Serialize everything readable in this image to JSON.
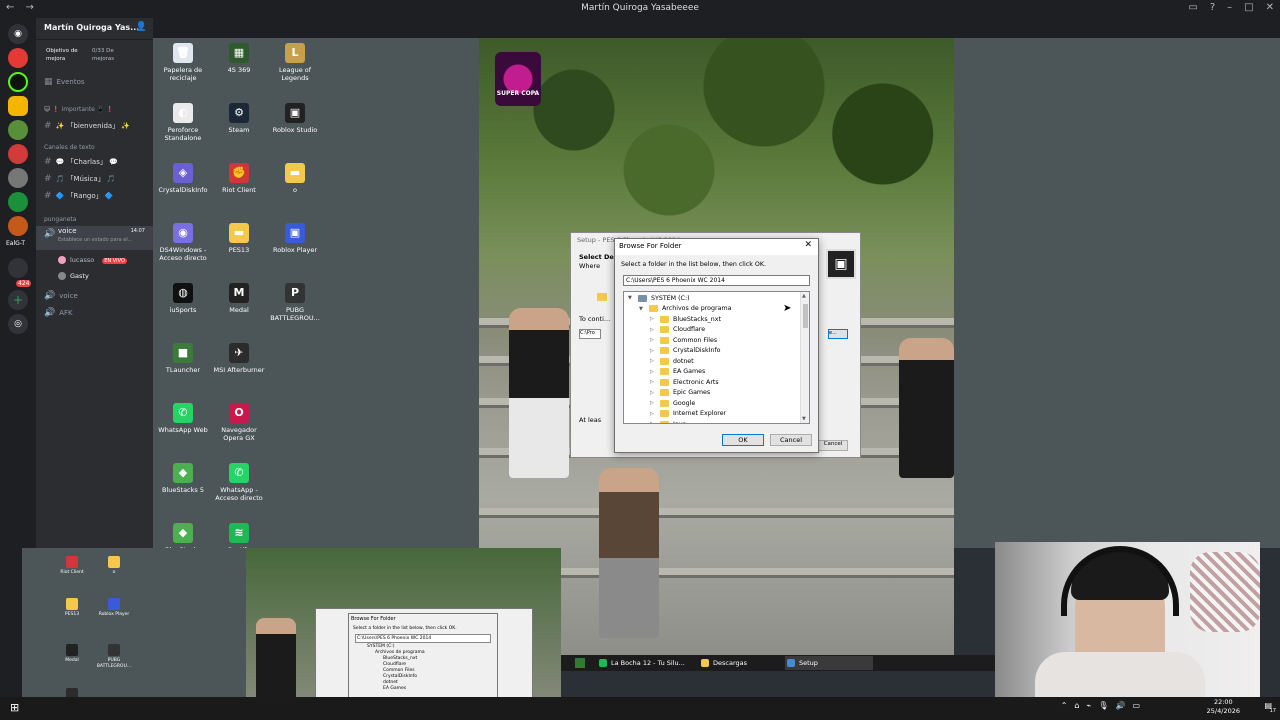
{
  "titlebar": {
    "title": "Martín Quiroga Yasabeeee",
    "nav": "← →"
  },
  "guild": {
    "name": "Martín Quiroga Yas...",
    "goal_label": "Objetivo de mejora",
    "goal_value": "0/33 De mejoras",
    "events": "Eventos"
  },
  "channels": {
    "important_cat": "😺 ❗ importante 📱 ❗",
    "welcome": "✨ 「bienvenida」 ✨",
    "text_cat": "Canales de texto",
    "chat": "💬 「Charlas」 💬",
    "music": "🎵 「Música」 🎵",
    "ranks": "🔷 「Rango」 🔷",
    "voice_cat": "punganeta",
    "voice_active": "voice",
    "voice_time": "14:07",
    "voice_status": "Establece un estado para el...",
    "user1": "lucasso",
    "user1_badge": "EN VIVO",
    "user2": "Gasty",
    "voice2": "voice",
    "afk": "AFK",
    "rail_badge": "424",
    "rail_label": "EalG-T"
  },
  "desktop_icons": [
    {
      "label": "Papelera de reciclaje",
      "color": "#dfe6ee",
      "glyph": "🗑"
    },
    {
      "label": "4S 369",
      "color": "#2e5a2e",
      "glyph": "▦"
    },
    {
      "label": "League of Legends",
      "color": "#c8a04a",
      "glyph": "L"
    },
    {
      "label": "Peroforce Standalone",
      "color": "#eaeaea",
      "glyph": "◐"
    },
    {
      "label": "Steam",
      "color": "#1b2838",
      "glyph": "⚙"
    },
    {
      "label": "Roblox Studio",
      "color": "#222",
      "glyph": "▣"
    },
    {
      "label": "CrystalDiskInfo",
      "color": "#6b5fd6",
      "glyph": "◈"
    },
    {
      "label": "Riot Client",
      "color": "#d13639",
      "glyph": "✊"
    },
    {
      "label": "o",
      "color": "#f4c84a",
      "glyph": "▬"
    },
    {
      "label": "DS4Windows - Acceso directo",
      "color": "#7a6fe0",
      "glyph": "◉"
    },
    {
      "label": "PES13",
      "color": "#f4c84a",
      "glyph": "▬"
    },
    {
      "label": "Roblox Player",
      "color": "#3a5bd9",
      "glyph": "▣"
    },
    {
      "label": "iuSports",
      "color": "#111",
      "glyph": "◍"
    },
    {
      "label": "Medal",
      "color": "#222",
      "glyph": "M"
    },
    {
      "label": "PUBG BATTLEGROU...",
      "color": "#333",
      "glyph": "P"
    },
    {
      "label": "TLauncher",
      "color": "#3b7a3b",
      "glyph": "■"
    },
    {
      "label": "MSI Afterburner",
      "color": "#2c2c2c",
      "glyph": "✈"
    },
    {
      "label": "",
      "color": "transparent",
      "glyph": ""
    },
    {
      "label": "WhatsApp Web",
      "color": "#25d366",
      "glyph": "✆"
    },
    {
      "label": "Navegador Opera GX",
      "color": "#c9184a",
      "glyph": "O"
    },
    {
      "label": "",
      "color": "transparent",
      "glyph": ""
    },
    {
      "label": "BlueStacks 5",
      "color": "#4caf50",
      "glyph": "◆"
    },
    {
      "label": "WhatsApp - Acceso directo",
      "color": "#25d366",
      "glyph": "✆"
    },
    {
      "label": "",
      "color": "transparent",
      "glyph": ""
    },
    {
      "label": "BlueStacks",
      "color": "#4caf50",
      "glyph": "◆"
    },
    {
      "label": "Spotify",
      "color": "#1db954",
      "glyph": "≋"
    }
  ],
  "photo": {
    "logo_text": "SUPER COPA"
  },
  "setup": {
    "title": "Setup - PES 6 Phoenix WC 2014",
    "heading": "Select De...",
    "sub": "Where",
    "to_cont": "To conti...",
    "path": "C:\\Pro",
    "atleast": "At leas",
    "cancel": "Cancel",
    "browse": "e..."
  },
  "dialog": {
    "title": "Browse For Folder",
    "instruction": "Select a folder in the list below, then click OK.",
    "path": "C:\\Users\\PES 6 Phoenix WC 2014",
    "tree": [
      {
        "label": "SYSTEM (C:)",
        "level": 0,
        "drive": true,
        "expanded": true
      },
      {
        "label": "Archivos de programa",
        "level": 1,
        "expanded": true
      },
      {
        "label": "BlueStacks_nxt",
        "level": 2
      },
      {
        "label": "Cloudflare",
        "level": 2
      },
      {
        "label": "Common Files",
        "level": 2
      },
      {
        "label": "CrystalDiskInfo",
        "level": 2
      },
      {
        "label": "dotnet",
        "level": 2
      },
      {
        "label": "EA Games",
        "level": 2
      },
      {
        "label": "Electronic Arts",
        "level": 2
      },
      {
        "label": "Epic Games",
        "level": 2
      },
      {
        "label": "Google",
        "level": 2
      },
      {
        "label": "Internet Explorer",
        "level": 2
      },
      {
        "label": "Java",
        "level": 2
      }
    ],
    "ok": "OK",
    "cancel": "Cancel"
  },
  "taskbar_inner": [
    {
      "label": "La Bocha 12 - Tu Silu...",
      "color": "#1db954"
    },
    {
      "label": "Descargas",
      "color": "#f4c84a"
    },
    {
      "label": "Setup",
      "color": "#4a8ad4"
    }
  ],
  "clock": {
    "time": "22:00",
    "date": "25/4/2026"
  },
  "notif_count": "17",
  "thumb_icons": [
    {
      "label": "Riot Client"
    },
    {
      "label": "o"
    },
    {
      "label": "PES13"
    },
    {
      "label": "Roblox Player"
    },
    {
      "label": "Medal"
    },
    {
      "label": "PUBG BATTLEGROU..."
    },
    {
      "label": "MSI Afterburner"
    }
  ],
  "mini_dialog": {
    "title": "Browse For Folder",
    "instruction": "Select a folder in the list below, then click OK.",
    "path": "C:\\Users\\PES 6 Phoenix WC 2014",
    "items": [
      "SYSTEM (C:)",
      "Archivos de programa",
      "BlueStacks_nxt",
      "Cloudflare",
      "Common Files",
      "CrystalDiskInfo",
      "dotnet",
      "EA Games"
    ]
  }
}
